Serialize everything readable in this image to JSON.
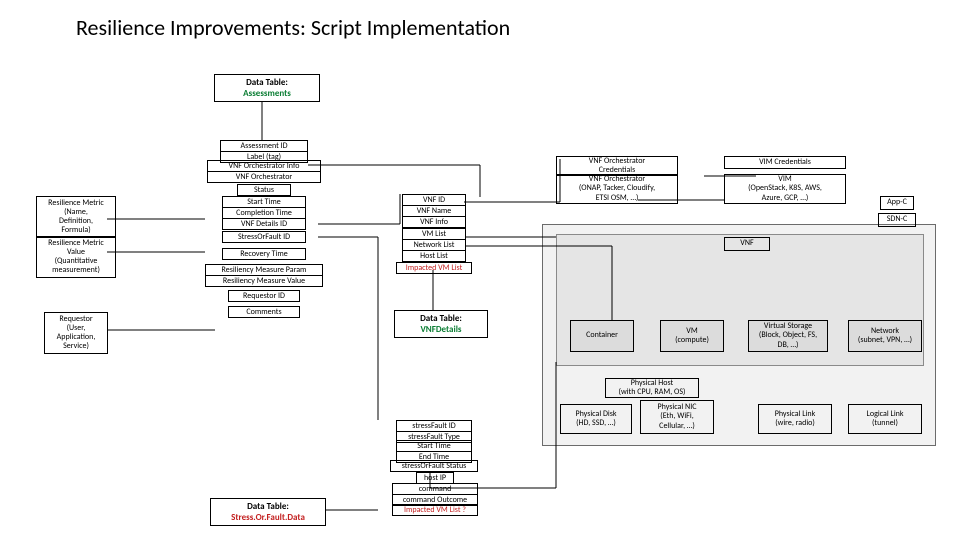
{
  "title": "Resilience Improvements: Script Implementation",
  "tables": {
    "assessments": {
      "title": "Data Table:",
      "sub": "Assessments"
    },
    "vnfdetails": {
      "title": "Data Table:",
      "sub": "VNFDetails"
    },
    "stressfault": {
      "title": "Data Table:",
      "sub": "Stress.Or.Fault.Data"
    }
  },
  "assess": {
    "id": "Assessment ID",
    "label": "Label (tag)",
    "orchInfo": "VNF Orchestrator Info",
    "orch": "VNF Orchestrator",
    "status": "Status",
    "start": "Start Time",
    "completion": "Completion Time",
    "vnfDetails": "VNF Details ID",
    "stressId": "StressOrFault ID",
    "recovery": "Recovery Time",
    "resParam": "Resiliency Measure Param",
    "resValue": "Resiliency Measure Value",
    "requestor": "Requestor ID",
    "comments": "Comments"
  },
  "left": {
    "metric": "Resilience Metric\n(Name,\nDefinition,\nFormula)",
    "value": "Resilience Metric\nValue\n(Quantitative\nmeasurement)",
    "requestor": "Requestor\n(User,\nApplication,\nService)"
  },
  "vnf": {
    "id": "VNF ID",
    "name": "VNF Name",
    "info": "VNF Info",
    "vmlist": "VM List",
    "netlist": "Network List",
    "hostlist": "Host List",
    "impacted": "Impacted VM List"
  },
  "right": {
    "orchCredT": "VNF Orchestrator\nCredentials",
    "orchCredB": "VNF Orchestrator\n(ONAP, Tacker, Cloudify,\nETSI OSM, …)",
    "vimCredT": "VIM Credentials",
    "vimCredB": "VIM\n(OpenStack, K8S, AWS,\nAzure, GCP, …)",
    "appc": "App-C",
    "sdnc": "SDN-C",
    "vnf": "VNF",
    "container": "Container",
    "vm": "VM\n(compute)",
    "vstorage": "Virtual Storage\n(Block, Object, FS,\nDB, …)",
    "network": "Network\n(subnet, VPN, …)",
    "phHost": "Physical Host\n(with CPU, RAM, OS)",
    "phDisk": "Physical Disk\n(HD, SSD, …)",
    "phNic": "Physical NIC\n(Eth, WiFi,\nCellular, …)",
    "phLink": "Physical Link\n(wire, radio)",
    "logLink": "Logical Link\n(tunnel)"
  },
  "fault": {
    "id": "stressFault ID",
    "type": "stressFault Type",
    "start": "Start Time",
    "end": "End Time",
    "status": "stressOrFault Status",
    "host": "host IP",
    "cmd": "command",
    "outcome": "command Outcome",
    "impacted": "Impacted VM List ?"
  }
}
